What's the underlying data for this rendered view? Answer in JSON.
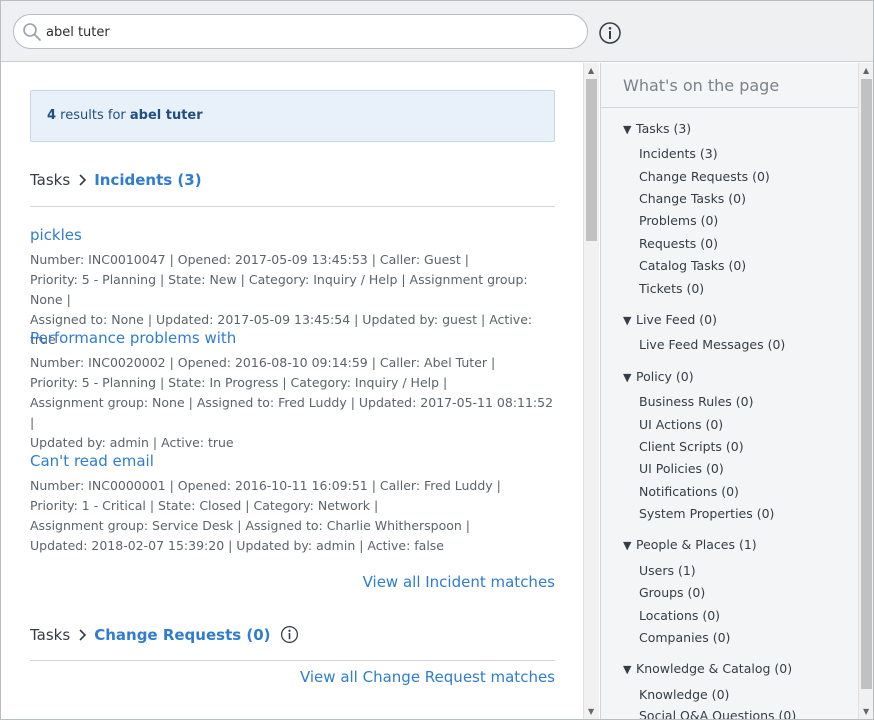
{
  "search": {
    "value": "abel tuter",
    "placeholder": ""
  },
  "summary": {
    "count": "4",
    "mid": " results for ",
    "term": "abel tuter"
  },
  "sections": {
    "incidents": {
      "prefix": "Tasks",
      "label": "Incidents (3)",
      "results": [
        {
          "title": "pickles",
          "lines": [
            "Number: INC0010047 | Opened: 2017-05-09 13:45:53 | Caller: Guest |",
            "Priority: 5 - Planning | State: New | Category: Inquiry / Help | Assignment group: None |",
            "Assigned to: None | Updated: 2017-05-09 13:45:54 | Updated by: guest | Active: true"
          ]
        },
        {
          "title": "Performance problems with",
          "lines": [
            "Number: INC0020002 | Opened: 2016-08-10 09:14:59 | Caller: Abel Tuter |",
            "Priority: 5 - Planning | State: In Progress | Category: Inquiry / Help |",
            "Assignment group: None | Assigned to: Fred Luddy | Updated: 2017-05-11 08:11:52 |",
            "Updated by: admin | Active: true"
          ]
        },
        {
          "title": "Can't read email",
          "lines": [
            "Number: INC0000001 | Opened: 2016-10-11 16:09:51 | Caller: Fred Luddy |",
            "Priority: 1 - Critical | State: Closed | Category: Network |",
            "Assignment group: Service Desk | Assigned to: Charlie Whitherspoon |",
            "Updated: 2018-02-07 15:39:20 | Updated by: admin | Active: false"
          ]
        }
      ],
      "view_all": "View all Incident matches"
    },
    "change_requests": {
      "prefix": "Tasks",
      "label": "Change Requests (0)",
      "view_all": "View all Change Request matches"
    }
  },
  "toc": {
    "title": "What's on the page",
    "groups": [
      {
        "label": "Tasks (3)",
        "items": [
          "Incidents (3)",
          "Change Requests (0)",
          "Change Tasks (0)",
          "Problems (0)",
          "Requests (0)",
          "Catalog Tasks (0)",
          "Tickets (0)"
        ]
      },
      {
        "label": "Live Feed (0)",
        "items": [
          "Live Feed Messages (0)"
        ]
      },
      {
        "label": "Policy (0)",
        "items": [
          "Business Rules (0)",
          "UI Actions (0)",
          "Client Scripts (0)",
          "UI Policies (0)",
          "Notifications (0)",
          "System Properties (0)"
        ]
      },
      {
        "label": "People & Places (1)",
        "items": [
          "Users (1)",
          "Groups (0)",
          "Locations (0)",
          "Companies (0)"
        ]
      },
      {
        "label": "Knowledge & Catalog (0)",
        "items": [
          "Knowledge (0)",
          "Social Q&A Questions (0)"
        ]
      }
    ]
  },
  "colors": {
    "link": "#2e7dd1",
    "summary_bg": "#e8f1fa",
    "toc_bg": "#f4f5f6"
  },
  "icons": {
    "search": "search-icon",
    "info": "info-icon",
    "chevron": "chevron-right-icon",
    "expand": "triangle-down-icon"
  }
}
